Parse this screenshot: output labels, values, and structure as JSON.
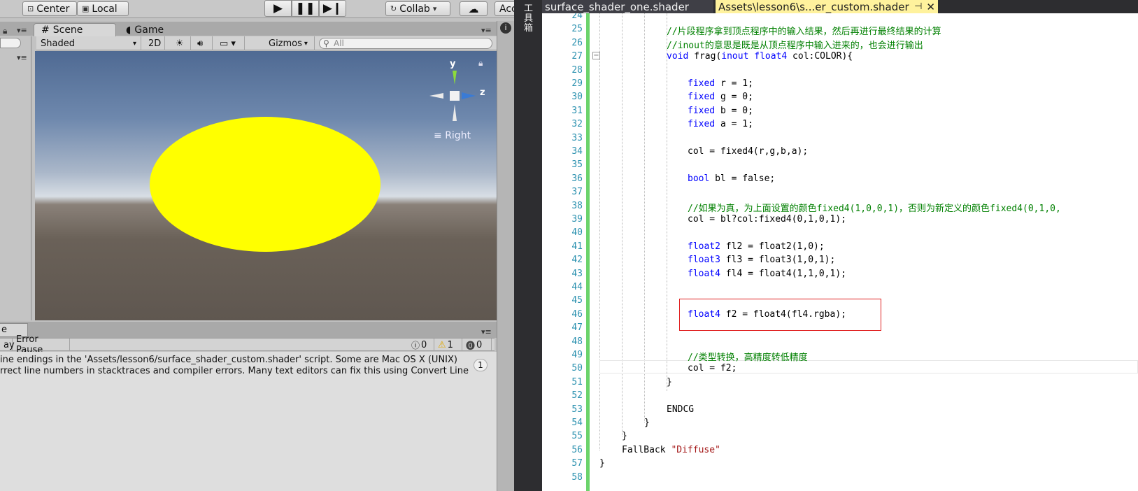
{
  "unity": {
    "toolbar": {
      "pivot_label": "Center",
      "space_label": "Local",
      "collab_label": "Collab",
      "account_label": "Acc",
      "play_icon": "play-icon",
      "pause_icon": "pause-icon",
      "step_icon": "step-icon"
    },
    "scene": {
      "tab_scene": "Scene",
      "tab_game": "Game",
      "shading_mode": "Shaded",
      "mode_2d": "2D",
      "gizmos_label": "Gizmos",
      "search_placeholder": "All",
      "gizmo_y": "y",
      "gizmo_z": "z",
      "view_label": "Right",
      "object_color": "#ffff00"
    },
    "console": {
      "tab_label": "e",
      "clear_on_play": "ay",
      "error_pause": "Error Pause",
      "info_count": "0",
      "warning_count": "1",
      "error_count": "0",
      "message_line1": "ine endings in the 'Assets/lesson6/surface_shader_custom.shader' script. Some are Mac OS X (UNIX)",
      "message_line2": "rrect line numbers in stacktraces and compiler errors. Many text editors can fix this using Convert Line",
      "collapse_count": "1"
    }
  },
  "vs": {
    "side_toolbox_label": "工具箱",
    "tabs": {
      "inactive": "surface_shader_one.shader",
      "active": "Assets\\lesson6\\s...er_custom.shader",
      "pin_icon": "pin-icon",
      "close_icon": "close-icon"
    },
    "editor": {
      "lines": [
        {
          "n": "24",
          "text": ""
        },
        {
          "n": "25",
          "text": "//片段程序拿到顶点程序中的输入结果，然后再进行最终结果的计算"
        },
        {
          "n": "26",
          "text": "//inout的意思是既是从顶点程序中输入进来的，也会进行输出"
        },
        {
          "n": "27",
          "text": "void frag(inout float4 col:COLOR){"
        },
        {
          "n": "28",
          "text": ""
        },
        {
          "n": "29",
          "text": "fixed r = 1;"
        },
        {
          "n": "30",
          "text": "fixed g = 0;"
        },
        {
          "n": "31",
          "text": "fixed b = 0;"
        },
        {
          "n": "32",
          "text": "fixed a = 1;"
        },
        {
          "n": "33",
          "text": ""
        },
        {
          "n": "34",
          "text": "col = fixed4(r,g,b,a);"
        },
        {
          "n": "35",
          "text": ""
        },
        {
          "n": "36",
          "text": "bool bl = false;"
        },
        {
          "n": "37",
          "text": ""
        },
        {
          "n": "38",
          "text": "//如果为真，为上面设置的颜色fixed4(1,0,0,1)，否则为新定义的颜色fixed4(0,1,0,"
        },
        {
          "n": "39",
          "text": "col = bl?col:fixed4(0,1,0,1);"
        },
        {
          "n": "40",
          "text": ""
        },
        {
          "n": "41",
          "text": "float2 fl2 = float2(1,0);"
        },
        {
          "n": "42",
          "text": "float3 fl3 = float3(1,0,1);"
        },
        {
          "n": "43",
          "text": "float4 fl4 = float4(1,1,0,1);"
        },
        {
          "n": "44",
          "text": ""
        },
        {
          "n": "45",
          "text": ""
        },
        {
          "n": "46",
          "text": "float4 f2 = float4(fl4.rgba);"
        },
        {
          "n": "47",
          "text": ""
        },
        {
          "n": "48",
          "text": ""
        },
        {
          "n": "49",
          "text": "//类型转换，高精度转低精度"
        },
        {
          "n": "50",
          "text": "col = f2;"
        },
        {
          "n": "51",
          "text": "}"
        },
        {
          "n": "52",
          "text": ""
        },
        {
          "n": "53",
          "text": "ENDCG"
        },
        {
          "n": "54",
          "text": "}"
        },
        {
          "n": "55",
          "text": "}"
        },
        {
          "n": "56",
          "text": "FallBack \"Diffuse\""
        },
        {
          "n": "57",
          "text": "}"
        },
        {
          "n": "58",
          "text": ""
        }
      ]
    }
  }
}
